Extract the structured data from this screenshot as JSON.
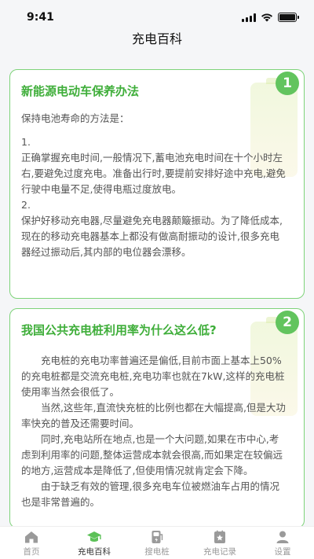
{
  "status_bar": {
    "time": "9:41"
  },
  "nav": {
    "title": "充电百科"
  },
  "articles": [
    {
      "badge": "1",
      "title": "新能源电动车保养办法",
      "paragraphs": [
        "保持电池寿命的方法是：",
        "1.",
        "正确掌握充电时间,一般情况下,蓄电池充电时间在十个小时左右,要避免过度充电。准备出行时,要提前安排好途中充电,避免行驶中电量不足,使得电瓶过度放电。",
        "2.",
        "保护好移动充电器,尽量避免充电器颠簸振动。为了降低成本,现在的移动充电器基本上都没有做高耐振动的设计,很多充电器经过振动后,其内部的电位器会漂移。"
      ]
    },
    {
      "badge": "2",
      "title": "我国公共充电桩利用率为什么这么低?",
      "paragraphs": [
        "充电桩的充电功率普遍还是偏低,目前市面上基本上50%的充电桩都是交流充电桩,充电功率也就在7kW,这样的充电桩使用率当然会很低了。",
        "当然,这些年,直流快充桩的比例也都在大幅提高,但是大功率快充的普及还需要时间。",
        "同时,充电站所在地点,也是一个大问题,如果在市中心,考虑到利用率的问题,整体运营成本就会很高,而如果定在较偏远的地方,运营成本是降低了,但使用情况就肯定会下降。",
        "由于缺乏有效的管理,很多充电车位被燃油车占用的情况也是非常普遍的。"
      ]
    }
  ],
  "tab_bar": {
    "items": [
      {
        "label": "首页",
        "icon": "home-icon",
        "active": false
      },
      {
        "label": "充电百科",
        "icon": "graduation-cap-icon",
        "active": true
      },
      {
        "label": "搜电桩",
        "icon": "charging-pile-icon",
        "active": false
      },
      {
        "label": "充电记录",
        "icon": "record-icon",
        "active": false
      },
      {
        "label": "设置",
        "icon": "user-icon",
        "active": false
      }
    ]
  },
  "colors": {
    "accent": "#3fae3a",
    "badge": "#62c45e",
    "card_border": "#7ed37a",
    "active_icon": "#5cc158",
    "inactive_icon": "#9a9a9a"
  }
}
